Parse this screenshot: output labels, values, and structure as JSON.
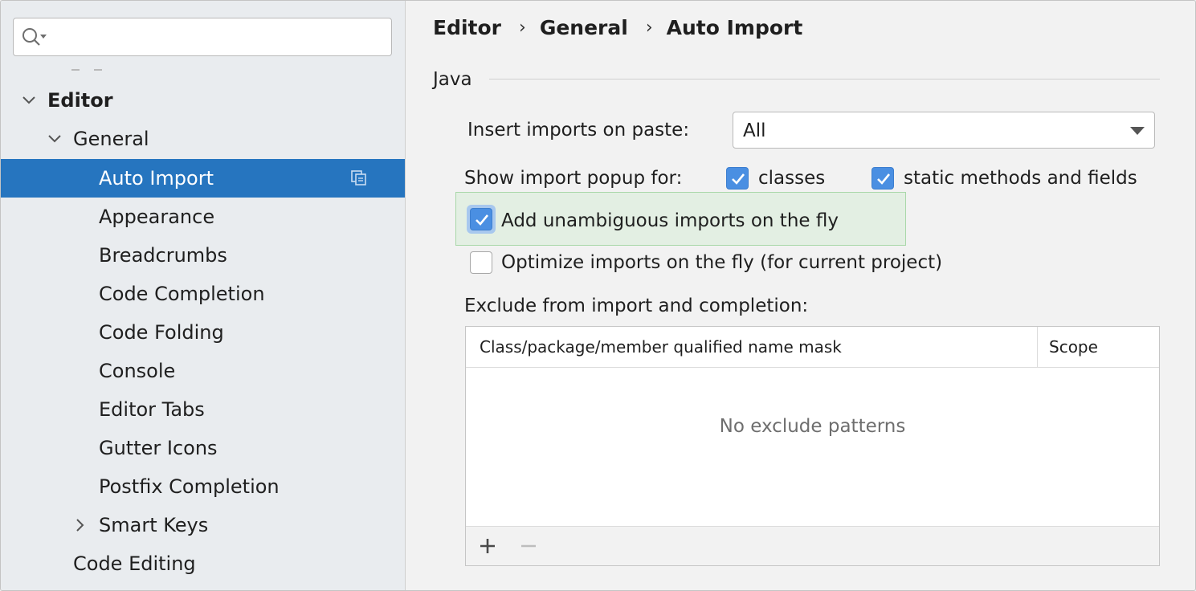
{
  "search": {
    "placeholder": ""
  },
  "sidebar": {
    "items": [
      {
        "label": "Editor",
        "expanded": true
      },
      {
        "label": "General",
        "expanded": true
      },
      {
        "label": "Auto Import",
        "selected": true
      },
      {
        "label": "Appearance"
      },
      {
        "label": "Breadcrumbs"
      },
      {
        "label": "Code Completion"
      },
      {
        "label": "Code Folding"
      },
      {
        "label": "Console"
      },
      {
        "label": "Editor Tabs"
      },
      {
        "label": "Gutter Icons"
      },
      {
        "label": "Postfix Completion"
      },
      {
        "label": "Smart Keys",
        "expanded": false
      },
      {
        "label": "Code Editing"
      }
    ]
  },
  "breadcrumb": [
    "Editor",
    "General",
    "Auto Import"
  ],
  "java": {
    "section_title": "Java",
    "insert_imports_label": "Insert imports on paste:",
    "insert_imports_value": "All",
    "show_popup_label": "Show import popup for:",
    "classes_label": "classes",
    "classes_checked": true,
    "static_label": "static methods and fields",
    "static_checked": true,
    "add_unambiguous_label": "Add unambiguous imports on the fly",
    "add_unambiguous_checked": true,
    "optimize_label": "Optimize imports on the fly (for current project)",
    "optimize_checked": false,
    "exclude_label": "Exclude from import and completion:"
  },
  "exclude_table": {
    "columns": [
      "Class/package/member qualified name mask",
      "Scope"
    ],
    "empty_text": "No exclude patterns",
    "add_symbol": "+",
    "remove_symbol": "−"
  },
  "colors": {
    "selection": "#2675bf",
    "checkbox": "#4a8fe2",
    "highlight": "#e3efe3"
  }
}
